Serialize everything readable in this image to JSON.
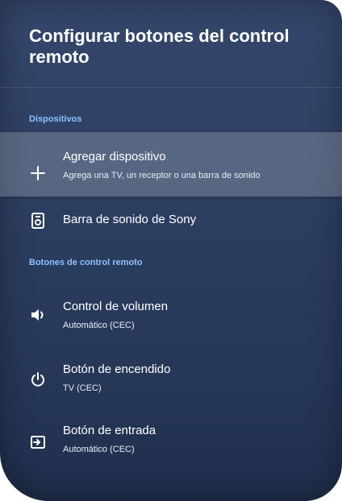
{
  "header": {
    "title": "Configurar botones del control remoto"
  },
  "sections": {
    "devices_header": "Dispositivos",
    "buttons_header": "Botones de control remoto"
  },
  "devices": {
    "add": {
      "label": "Agregar dispositivo",
      "description": "Agrega una TV, un receptor o una barra de sonido",
      "icon": "plus-icon"
    },
    "soundbar": {
      "label": "Barra de sonido de Sony",
      "icon": "soundbar-icon"
    }
  },
  "remote_buttons": {
    "volume": {
      "label": "Control de volumen",
      "value": "Automático (CEC)",
      "icon": "volume-icon"
    },
    "power": {
      "label": "Botón de encendido",
      "value": "TV (CEC)",
      "icon": "power-icon"
    },
    "input": {
      "label": "Botón de entrada",
      "value": "Automático (CEC)",
      "icon": "input-icon"
    }
  },
  "colors": {
    "background": "#2d3f61",
    "section_header": "#8ec0ff",
    "text": "#ffffff"
  }
}
